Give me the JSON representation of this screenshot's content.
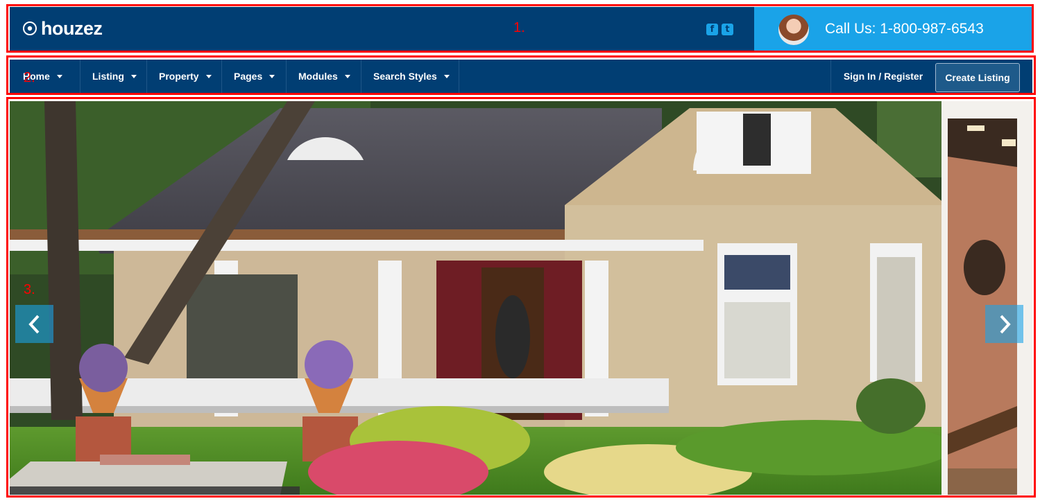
{
  "annotations": [
    "1.",
    "2.",
    "3."
  ],
  "header": {
    "logo_text": "houzez",
    "social": [
      "facebook",
      "twitter"
    ],
    "call_text": "Call Us: 1-800-987-6543"
  },
  "nav": {
    "items": [
      {
        "label": "Home"
      },
      {
        "label": "Listing"
      },
      {
        "label": "Property"
      },
      {
        "label": "Pages"
      },
      {
        "label": "Modules"
      },
      {
        "label": "Search Styles"
      }
    ],
    "signin_label": "Sign In / Register",
    "create_label": "Create Listing"
  },
  "slider": {
    "prev_icon": "chevron-left-icon",
    "next_icon": "chevron-right-icon"
  },
  "colors": {
    "primary": "#013e73",
    "accent": "#1aa3e8",
    "annotation": "#ff0000"
  }
}
